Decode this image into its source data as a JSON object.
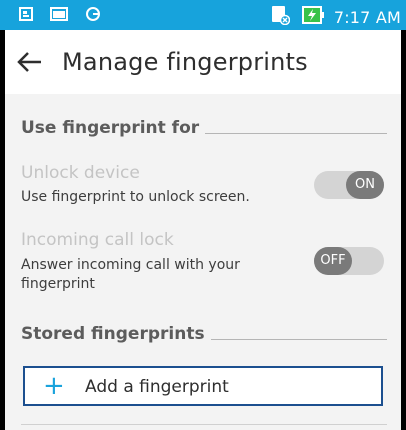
{
  "status_bar": {
    "time": "7:17 AM",
    "left_icons": [
      "sim-icon",
      "image-icon",
      "sync-icon"
    ],
    "right_icons": [
      "no-sim-icon",
      "battery-charging-icon"
    ],
    "background": "#17a3dc"
  },
  "app_bar": {
    "back_icon": "back-arrow-icon",
    "title": "Manage fingerprints"
  },
  "sections": {
    "use_for": {
      "title": "Use fingerprint for"
    },
    "stored": {
      "title": "Stored fingerprints"
    }
  },
  "settings": {
    "unlock": {
      "title": "Unlock device",
      "subtitle": "Use fingerprint to unlock screen.",
      "toggle_label": "ON",
      "toggle_state": "on"
    },
    "call_lock": {
      "title": "Incoming call lock",
      "subtitle_line1": "Answer incoming call with your",
      "subtitle_line2": "fingerprint",
      "toggle_label": "OFF",
      "toggle_state": "off"
    }
  },
  "add_fingerprint": {
    "icon": "plus-icon",
    "label": "Add a fingerprint",
    "accent": "#1aa3dc",
    "border": "#1c4f8f"
  }
}
